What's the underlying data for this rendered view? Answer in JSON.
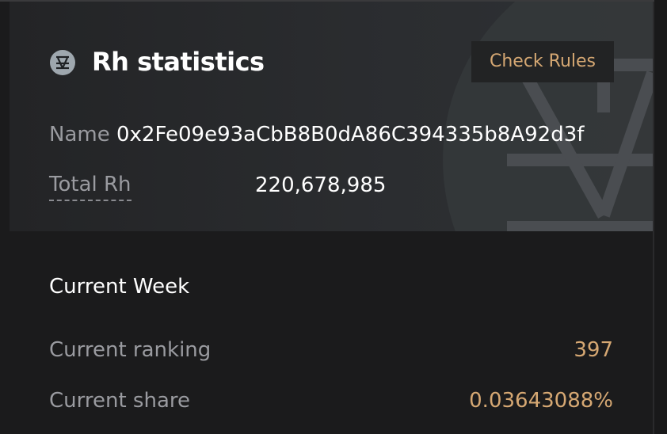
{
  "card": {
    "title": "Rh statistics",
    "logo_icon": "rh-token-icon",
    "check_rules_label": "Check Rules",
    "name_label": "Name",
    "name_value": "0x2Fe09e93aCbB8B0dA86C394335b8A92d3f",
    "total_label": "Total Rh",
    "total_value": "220,678,985"
  },
  "current_week": {
    "title": "Current Week",
    "rows": [
      {
        "label": "Current ranking",
        "value": "397"
      },
      {
        "label": "Current share",
        "value": "0.03643088%"
      }
    ]
  },
  "colors": {
    "accent": "#d6a873",
    "muted_text": "#9a9ba0",
    "background": "#1b1b1c"
  }
}
